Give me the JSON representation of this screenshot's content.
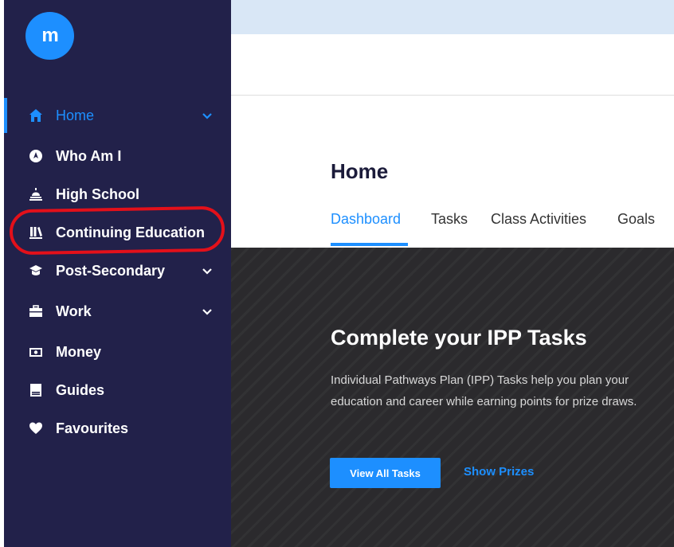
{
  "app": {
    "logo_letter": "m"
  },
  "sidebar": {
    "items": [
      {
        "label": "Home",
        "icon": "home-icon",
        "active": true,
        "expandable": true
      },
      {
        "label": "Who Am I",
        "icon": "compass-icon",
        "active": false,
        "expandable": false
      },
      {
        "label": "High School",
        "icon": "school-bell-icon",
        "active": false,
        "expandable": false
      },
      {
        "label": "Continuing Education",
        "icon": "library-books-icon",
        "active": false,
        "expandable": false,
        "highlighted": true
      },
      {
        "label": "Post-Secondary",
        "icon": "graduation-cap-icon",
        "active": false,
        "expandable": true
      },
      {
        "label": "Work",
        "icon": "briefcase-icon",
        "active": false,
        "expandable": true
      },
      {
        "label": "Money",
        "icon": "money-icon",
        "active": false,
        "expandable": false
      },
      {
        "label": "Guides",
        "icon": "book-icon",
        "active": false,
        "expandable": false
      },
      {
        "label": "Favourites",
        "icon": "heart-icon",
        "active": false,
        "expandable": false
      }
    ]
  },
  "main": {
    "title": "Home",
    "tabs": [
      {
        "label": "Dashboard",
        "active": true
      },
      {
        "label": "Tasks",
        "active": false
      },
      {
        "label": "Class Activities",
        "active": false
      },
      {
        "label": "Goals",
        "active": false
      }
    ]
  },
  "hero": {
    "title": "Complete your IPP Tasks",
    "description": "Individual Pathways Plan (IPP) Tasks help you plan your education and career while earning points for prize draws.",
    "primary_button": "View All Tasks",
    "secondary_link": "Show Prizes"
  },
  "colors": {
    "sidebar_bg": "#22214a",
    "accent": "#1d8fff",
    "topbar": "#d9e7f6",
    "hero_bg": "#2b2a2d",
    "annotation_ring": "#e3101a"
  }
}
